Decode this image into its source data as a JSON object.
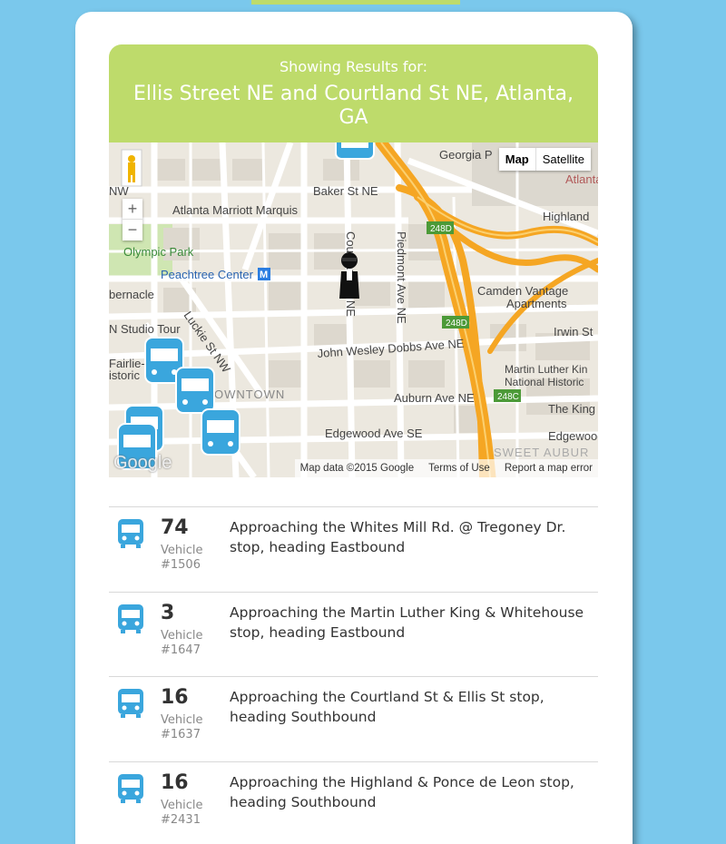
{
  "header": {
    "subtitle": "Showing Results for:",
    "location": "Ellis Street NE and Courtland St NE, Atlanta, GA"
  },
  "map": {
    "type_buttons": [
      "Map",
      "Satellite"
    ],
    "zoom_in": "+",
    "zoom_out": "−",
    "labels": {
      "georgia": "Georgia P",
      "atlanta": "Atlanta",
      "baker": "Baker St NE",
      "marriott": "Atlanta Marriott Marquis",
      "highland": "Highland",
      "olympic": "Olympic Park",
      "peachtree": "Peachtree Center",
      "courtland": "Courtland St NE",
      "piedmont": "Piedmont Ave NE",
      "tabernacle": "bernacle",
      "camden": "Camden Vantage",
      "apartments": "Apartments",
      "cnn": "N Studio Tour",
      "luckie": "Luckie St NW",
      "irwin": "Irwin St",
      "jwd": "John Wesley Dobbs Ave NE",
      "fairlie": "Fairlie-",
      "historic": "istoric",
      "mlk1": "Martin Luther Kin",
      "mlk2": "National Historic",
      "downtown": "OWNTOWN",
      "auburn": "Auburn Ave NE",
      "theking": "The King",
      "edgewood": "Edgewood Ave SE",
      "edgewood2": "Edgewood",
      "sweet": "SWEET AUBUR",
      "nw": "NW",
      "shield1": "248D",
      "shield2": "248D",
      "shield3": "248C"
    },
    "footer": [
      "Map data ©2015 Google",
      "Terms of Use",
      "Report a map error"
    ],
    "logo": "Google"
  },
  "vehicles": [
    {
      "route": "74",
      "vehicle_label": "Vehicle",
      "vehicle_id": "#1506",
      "description": "Approaching the Whites Mill Rd. @ Tregoney Dr. stop, heading Eastbound"
    },
    {
      "route": "3",
      "vehicle_label": "Vehicle",
      "vehicle_id": "#1647",
      "description": "Approaching the Martin Luther King & Whitehouse stop, heading Eastbound"
    },
    {
      "route": "16",
      "vehicle_label": "Vehicle",
      "vehicle_id": "#1637",
      "description": "Approaching the Courtland St & Ellis St stop, heading Southbound"
    },
    {
      "route": "16",
      "vehicle_label": "Vehicle",
      "vehicle_id": "#2431",
      "description": "Approaching the Highland & Ponce de Leon stop, heading Southbound"
    }
  ],
  "colors": {
    "accent": "#bedb6b",
    "background": "#7ac8ec",
    "bus_icon": "#3aa6dd",
    "highway": "#f5a623"
  },
  "icons": [
    "bus-icon",
    "pegman-icon",
    "marker-person-icon",
    "metro-icon"
  ]
}
